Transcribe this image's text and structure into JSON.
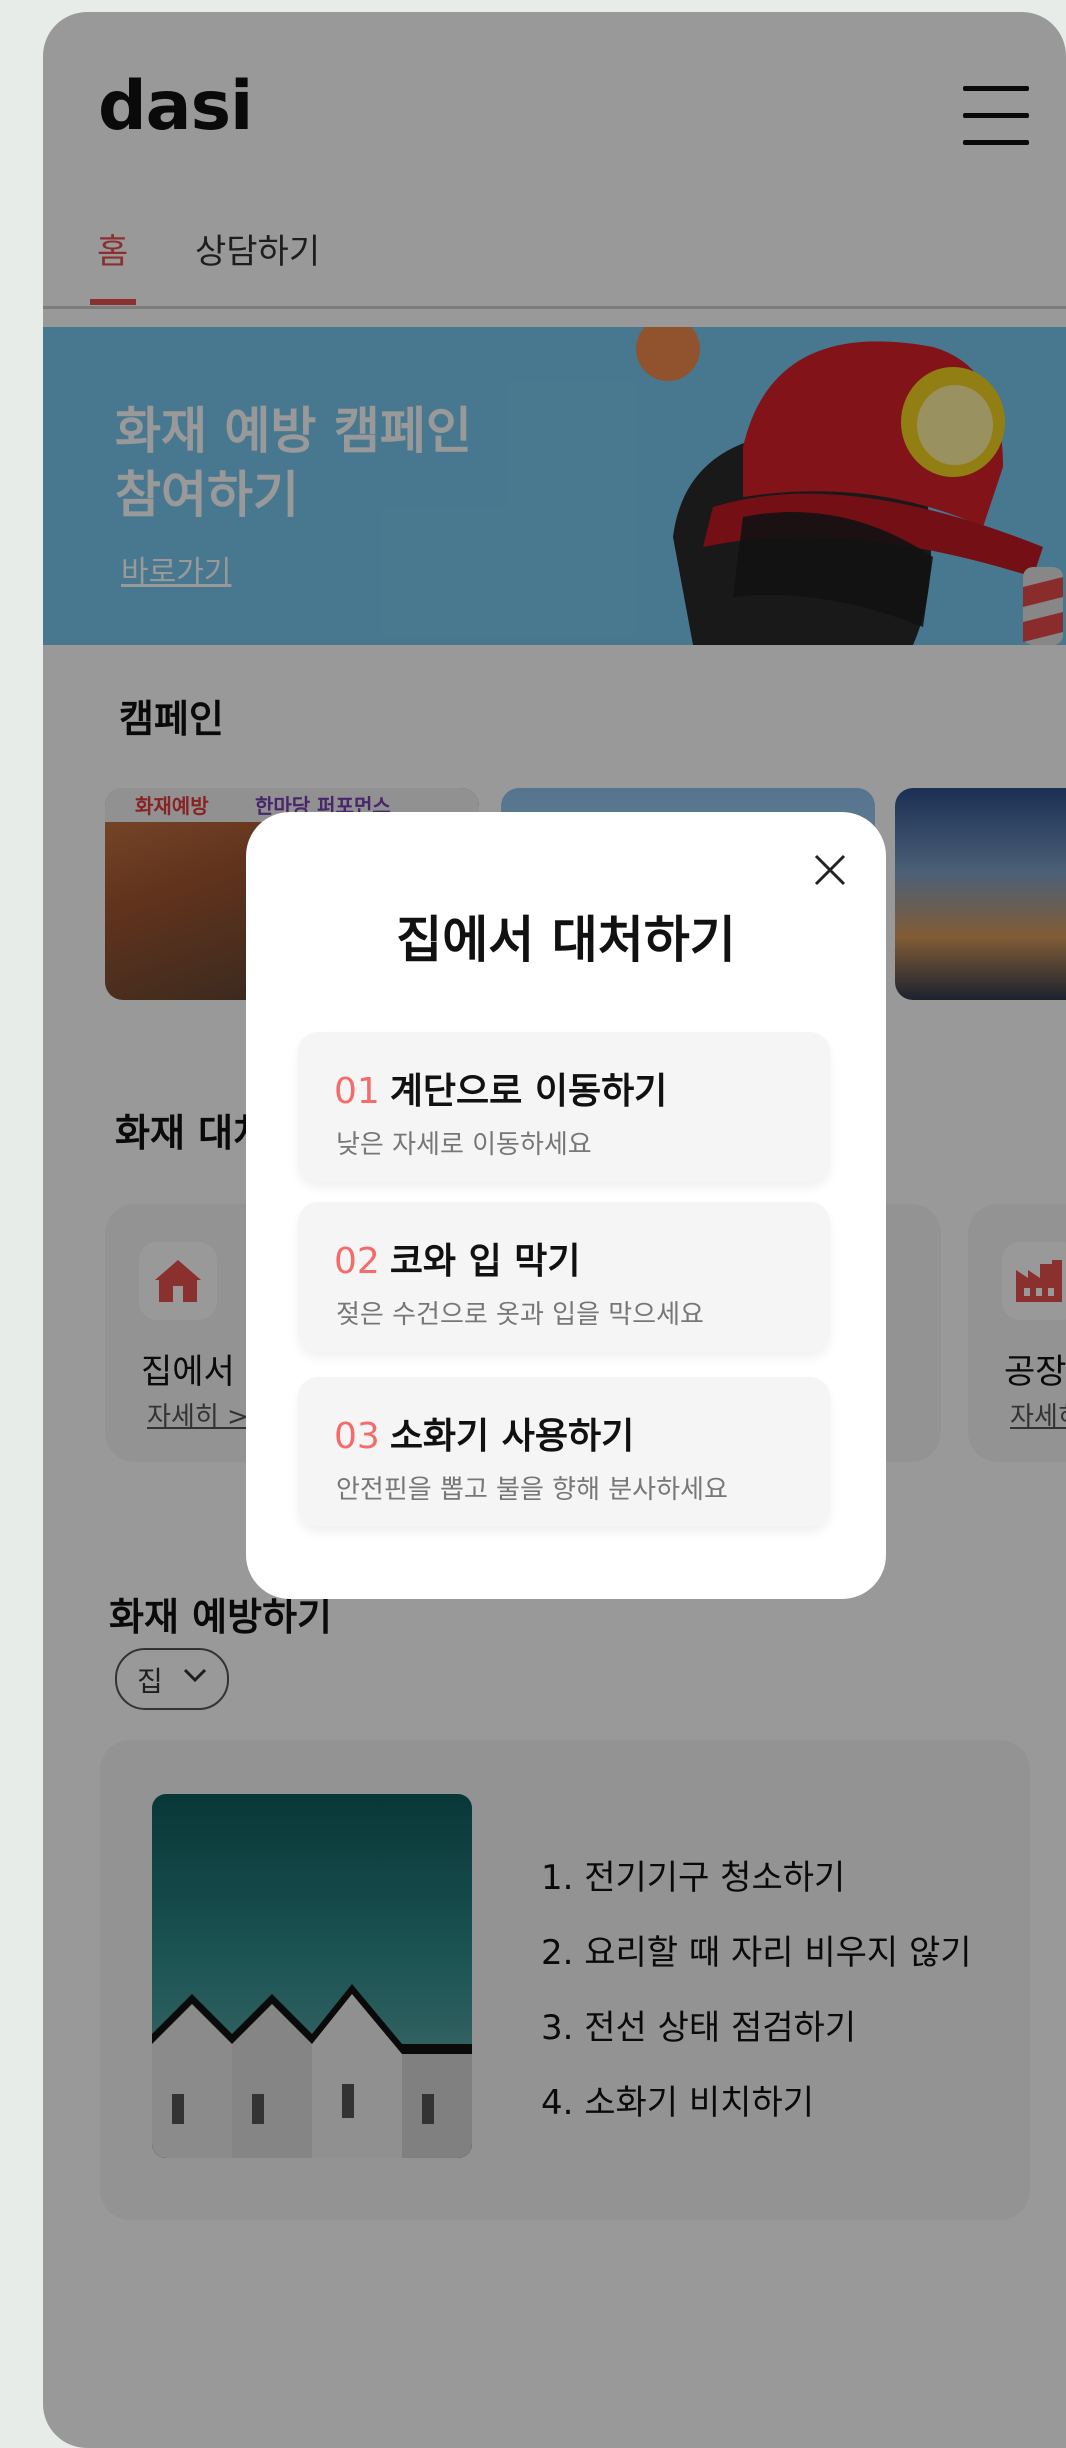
{
  "app": {
    "logo": "dasi"
  },
  "tabs": [
    {
      "label": "홈",
      "active": true
    },
    {
      "label": "상담하기",
      "active": false
    }
  ],
  "banner": {
    "title": "화재 예방 캠페인\n참여하기",
    "link": "바로가기"
  },
  "campaign": {
    "title": "캠페인",
    "card1_banner": [
      "화재예방",
      "한마당 퍼포먼스"
    ]
  },
  "response": {
    "title": "화재 대처하기",
    "cards": [
      {
        "label": "집에서 대처하기",
        "more": "자세히 >"
      },
      {
        "label": "공장에서 대처하기",
        "more": "자세히 >"
      }
    ]
  },
  "prevent": {
    "title": "화재 예방하기",
    "filter": "집",
    "items": [
      "1. 전기기구 청소하기",
      "2. 요리할 때 자리 비우지 않기",
      "3. 전선 상태 점검하기",
      "4. 소화기 비치하기"
    ]
  },
  "modal": {
    "title": "집에서 대처하기",
    "steps": [
      {
        "num": "01",
        "title": "계단으로 이동하기",
        "desc": "낮은 자세로 이동하세요"
      },
      {
        "num": "02",
        "title": "코와 입 막기",
        "desc": "젖은 수건으로 옷과 입을 막으세요"
      },
      {
        "num": "03",
        "title": "소화기 사용하기",
        "desc": "안전핀을 뽑고 불을 향해 분사하세요"
      }
    ]
  },
  "colors": {
    "accent": "#e7524f",
    "banner": "#79c9ef",
    "card": "#f5f5f5"
  }
}
